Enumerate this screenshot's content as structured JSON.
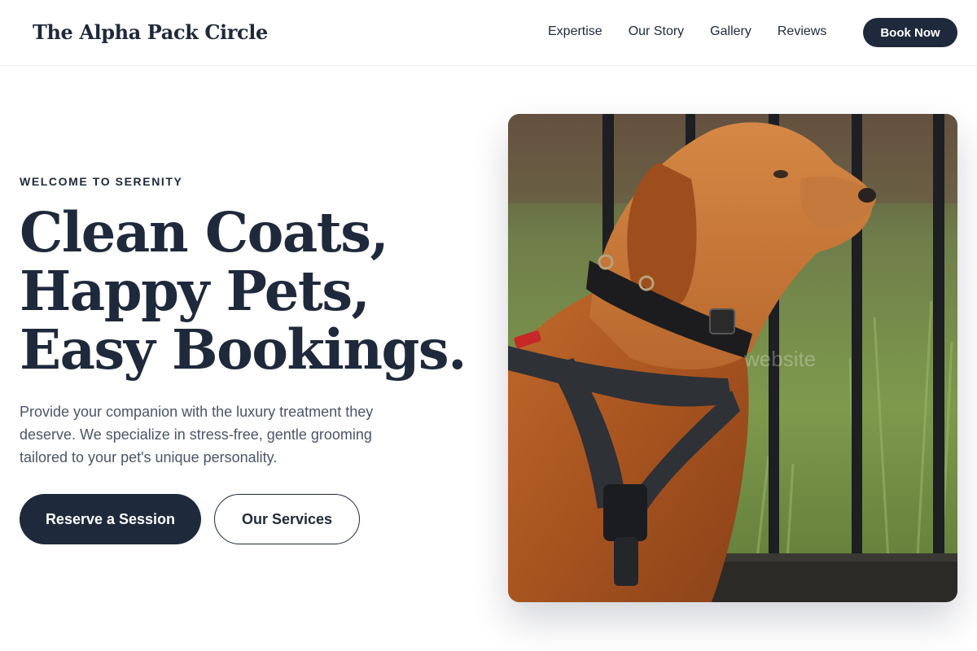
{
  "brand": {
    "name": "The Alpha Pack Circle"
  },
  "nav": {
    "links": [
      {
        "label": "Expertise"
      },
      {
        "label": "Our Story"
      },
      {
        "label": "Gallery"
      },
      {
        "label": "Reviews"
      }
    ],
    "cta_label": "Book Now"
  },
  "hero": {
    "eyebrow": "WELCOME TO SERENITY",
    "headline": [
      "Clean Coats,",
      "Happy Pets,",
      "Easy Bookings."
    ],
    "description": "Provide your companion with the luxury treatment they deserve. We specialize in stress-free, gentle grooming tailored to your pet's unique personality.",
    "primary_cta": "Reserve a Session",
    "secondary_cta": "Our Services"
  },
  "image": {
    "subject": "dog-photo",
    "watermark": "website"
  },
  "colors": {
    "primary": "#1e293b",
    "body_text": "#4a5568",
    "background": "#ffffff"
  }
}
